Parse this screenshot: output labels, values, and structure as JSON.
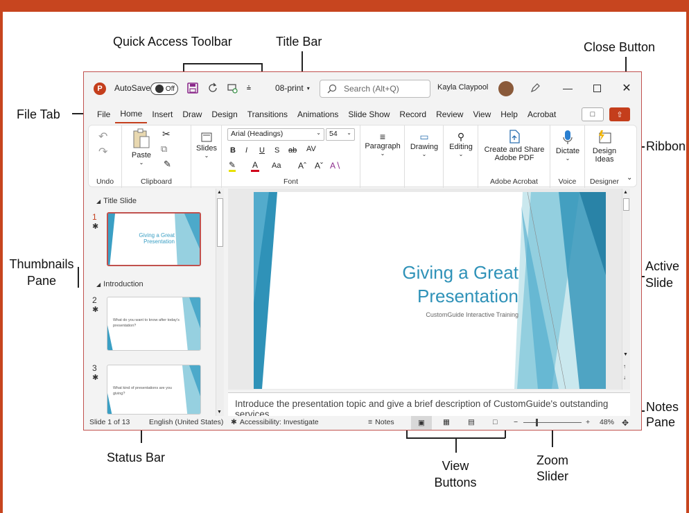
{
  "callouts": {
    "quick_access_toolbar": "Quick Access Toolbar",
    "title_bar": "Title Bar",
    "close_button": "Close Button",
    "file_tab": "File Tab",
    "ribbon": "Ribbon",
    "thumbnails_pane_1": "Thumbnails",
    "thumbnails_pane_2": "Pane",
    "active_slide_1": "Active",
    "active_slide_2": "Slide",
    "notes_pane_1": "Notes",
    "notes_pane_2": "Pane",
    "status_bar": "Status Bar",
    "view_buttons_1": "View",
    "view_buttons_2": "Buttons",
    "zoom_slider_1": "Zoom",
    "zoom_slider_2": "Slider"
  },
  "titlebar": {
    "logo": "P",
    "autosave_label": "AutoSave",
    "autosave_state": "Off",
    "filename": "08-print",
    "search_placeholder": "Search (Alt+Q)",
    "user_name": "Kayla Claypool"
  },
  "tabs": [
    "File",
    "Home",
    "Insert",
    "Draw",
    "Design",
    "Transitions",
    "Animations",
    "Slide Show",
    "Record",
    "Review",
    "View",
    "Help",
    "Acrobat"
  ],
  "ribbon": {
    "undo_label": "Undo",
    "clipboard_label": "Clipboard",
    "paste": "Paste",
    "slides": "Slides",
    "font_name": "Arial (Headings)",
    "font_size": "54",
    "font_label": "Font",
    "bold": "B",
    "italic": "I",
    "underline": "U",
    "shadow": "S",
    "strike": "ab",
    "spacing": "AV",
    "case": "Aa",
    "paragraph": "Paragraph",
    "drawing": "Drawing",
    "editing": "Editing",
    "create_share": "Create and Share",
    "adobe_pdf": "Adobe PDF",
    "adobe_label": "Adobe Acrobat",
    "dictate": "Dictate",
    "voice_label": "Voice",
    "design_ideas_1": "Design",
    "design_ideas_2": "Ideas",
    "designer_label": "Designer"
  },
  "thumbnails": {
    "section1": "Title Slide",
    "section2": "Introduction",
    "slide1_num": "1",
    "slide2_num": "2",
    "slide3_num": "3",
    "slide1_title_1": "Giving a Great",
    "slide1_title_2": "Presentation",
    "slide2_text_1": "What do you want to know after today's",
    "slide2_text_2": "presentation?",
    "slide3_text_1": "What kind of presentations are you",
    "slide3_text_2": "giving?"
  },
  "slide": {
    "title_1": "Giving a Great",
    "title_2": "Presentation",
    "subtitle": "CustomGuide Interactive Training"
  },
  "notes": {
    "line1": "Introduce the presentation topic and give a brief description of CustomGuide's outstanding",
    "line2": "services."
  },
  "statusbar": {
    "slide_count": "Slide 1 of 13",
    "language": "English (United States)",
    "accessibility": "Accessibility: Investigate",
    "notes": "Notes",
    "zoom": "48%"
  },
  "colors": {
    "brand": "#c43e1c",
    "accent": "#3a9fc4",
    "border": "#c0504d"
  }
}
